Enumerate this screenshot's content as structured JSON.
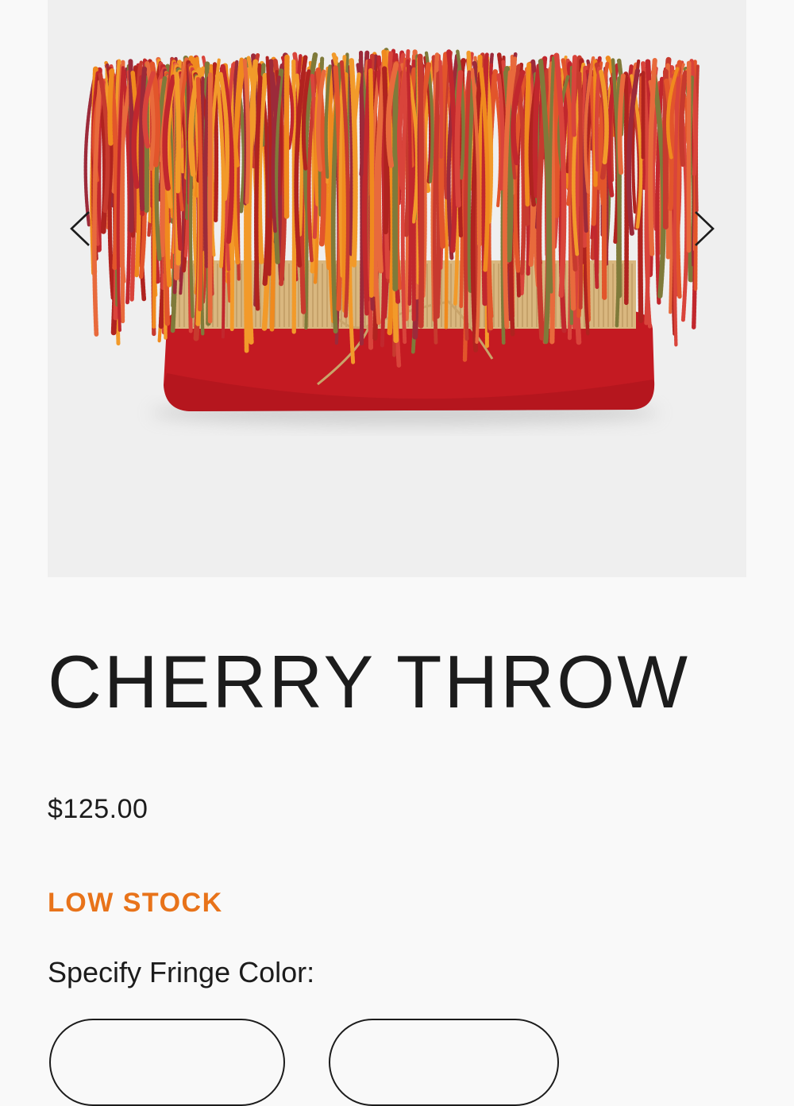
{
  "product": {
    "title": "CHERRY THROW",
    "price": "$125.00",
    "stock_status": "LOW STOCK",
    "image_alt": "Cherry Throw pillow with multicolored fringe"
  },
  "options": {
    "fringe_color_label": "Specify Fringe Color:",
    "swatches": [
      "",
      ""
    ]
  },
  "gallery": {
    "prev_icon": "chevron-left-icon",
    "next_icon": "chevron-right-icon"
  },
  "colors": {
    "stock_accent": "#e8731a",
    "text": "#1c1c1c",
    "gallery_bg": "#efefef",
    "page_bg": "#f9f9f9",
    "pillow_red": "#c41a22",
    "band_tan": "#d9b77f"
  }
}
